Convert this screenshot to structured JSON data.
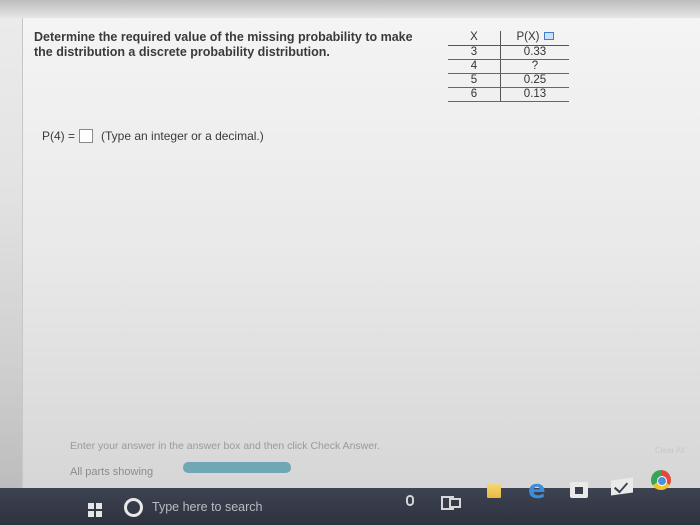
{
  "question": {
    "line1": "Determine the required value of the missing probability to make",
    "line2": "the distribution a discrete probability distribution."
  },
  "table": {
    "headers": {
      "x": "X",
      "px": "P(X)"
    },
    "rows": [
      {
        "x": "3",
        "px": "0.33"
      },
      {
        "x": "4",
        "px": "?"
      },
      {
        "x": "5",
        "px": "0.25"
      },
      {
        "x": "6",
        "px": "0.13"
      }
    ]
  },
  "answer": {
    "label": "P(4) =",
    "value": "",
    "hint": "(Type an integer or a decimal.)"
  },
  "footer": {
    "instruction": "Enter your answer in the answer box and then click Check Answer.",
    "parts_label": "All parts showing",
    "progress_fraction": 1.0,
    "check_hint": "Clear All"
  },
  "taskbar": {
    "search_placeholder": "Type here to search"
  }
}
